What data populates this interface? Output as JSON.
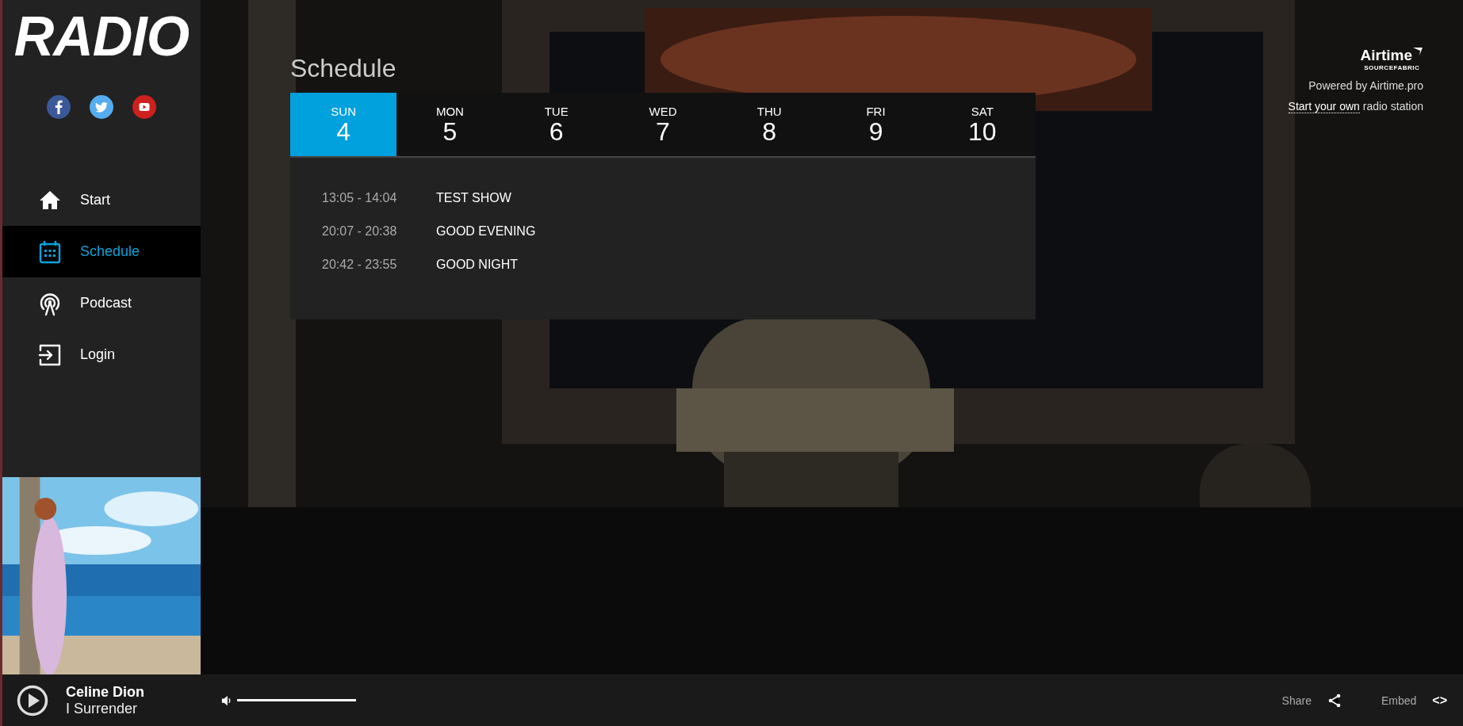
{
  "sidebar": {
    "logo": "RADIO",
    "social": [
      {
        "kind": "facebook",
        "color": "#3b5998"
      },
      {
        "kind": "twitter",
        "color": "#55acee"
      },
      {
        "kind": "youtube",
        "color": "#cd201f"
      }
    ],
    "items": [
      {
        "label": "Start",
        "kind": "home",
        "selected": false
      },
      {
        "label": "Schedule",
        "kind": "calendar",
        "selected": true
      },
      {
        "label": "Podcast",
        "kind": "podcast",
        "selected": false
      },
      {
        "label": "Login",
        "kind": "login",
        "selected": false
      }
    ]
  },
  "schedule": {
    "title": "Schedule",
    "days": [
      {
        "name": "SUN",
        "date": "4",
        "selected": true
      },
      {
        "name": "MON",
        "date": "5",
        "selected": false
      },
      {
        "name": "TUE",
        "date": "6",
        "selected": false
      },
      {
        "name": "WED",
        "date": "7",
        "selected": false
      },
      {
        "name": "THU",
        "date": "8",
        "selected": false
      },
      {
        "name": "FRI",
        "date": "9",
        "selected": false
      },
      {
        "name": "SAT",
        "date": "10",
        "selected": false
      }
    ],
    "shows": [
      {
        "time": "13:05 - 14:04",
        "name": "TEST SHOW"
      },
      {
        "time": "20:07 - 20:38",
        "name": "GOOD EVENING"
      },
      {
        "time": "20:42 - 23:55",
        "name": "GOOD NIGHT"
      }
    ]
  },
  "branding": {
    "logo": "Airtime",
    "logo_sub": "SOURCEFABRIC",
    "powered": "Powered by Airtime.pro",
    "link": "Start your own",
    "link_rest": "radio station"
  },
  "player": {
    "artist": "Celine Dion",
    "track": "I Surrender",
    "volume": {
      "level": 1
    },
    "share": "Share",
    "embed": "Embed",
    "embed_icon": "<>"
  }
}
